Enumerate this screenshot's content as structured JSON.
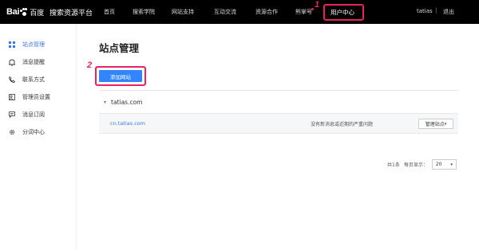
{
  "header": {
    "logo_bai": "Bai",
    "logo_cn": "百度",
    "platform_name": "搜索资源平台",
    "nav": [
      "首页",
      "搜索学院",
      "网站支持",
      "互动交流",
      "资源合作",
      "熊掌号",
      "用户中心"
    ],
    "user_name": "tatias",
    "separator": "|",
    "logout_label": "退出"
  },
  "sidebar": {
    "items": [
      {
        "label": "站点管理",
        "icon": "grid-icon",
        "active": true
      },
      {
        "label": "消息提醒",
        "icon": "bell-icon",
        "active": false
      },
      {
        "label": "联系方式",
        "icon": "phone-icon",
        "active": false
      },
      {
        "label": "管理员设置",
        "icon": "admin-icon",
        "active": false
      },
      {
        "label": "消息订阅",
        "icon": "chat-icon",
        "active": false
      },
      {
        "label": "分词中心",
        "icon": "gear-icon",
        "active": false
      }
    ]
  },
  "main": {
    "title": "站点管理",
    "add_site_label": "添加网站",
    "group_name": "tatias.com",
    "group_toggle": "▾",
    "sites": [
      {
        "url": "cn.tatias.com",
        "message": "没有新消息或近期的严重问题",
        "manage_label": "管理站点"
      }
    ],
    "pagination": {
      "total_text": "共1条",
      "per_page_label": "每页显示：",
      "per_page_value": "20"
    }
  },
  "annotations": {
    "step1": "1",
    "step2": "2"
  },
  "colors": {
    "accent": "#3385ff",
    "highlight": "#e8235f",
    "topbar": "#000000"
  }
}
